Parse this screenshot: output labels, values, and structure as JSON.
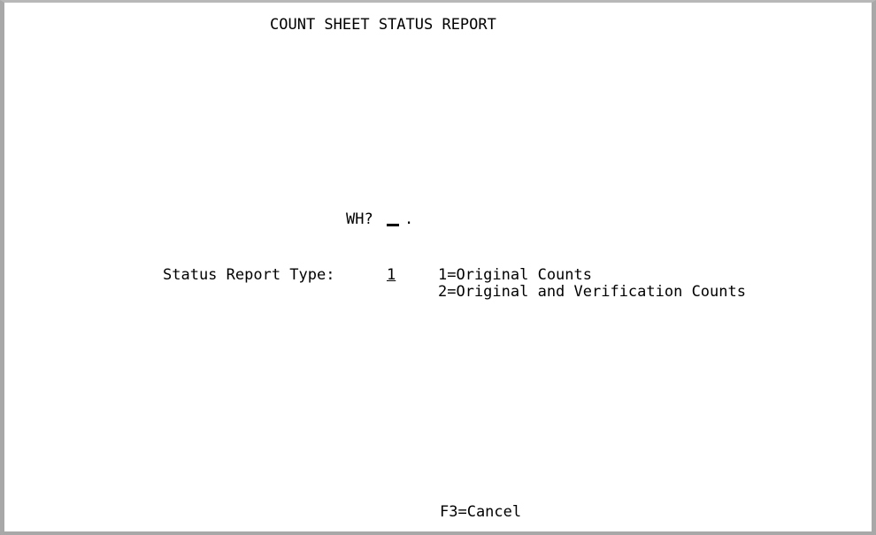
{
  "screen": {
    "title": "COUNT SHEET STATUS REPORT",
    "wh_label": "WH?",
    "wh_value": "",
    "wh_terminator": ".",
    "status_label": "Status Report Type:",
    "status_value": "1",
    "status_options": [
      "1=Original Counts",
      "2=Original and Verification Counts"
    ],
    "footer_key": "F3=Cancel"
  }
}
